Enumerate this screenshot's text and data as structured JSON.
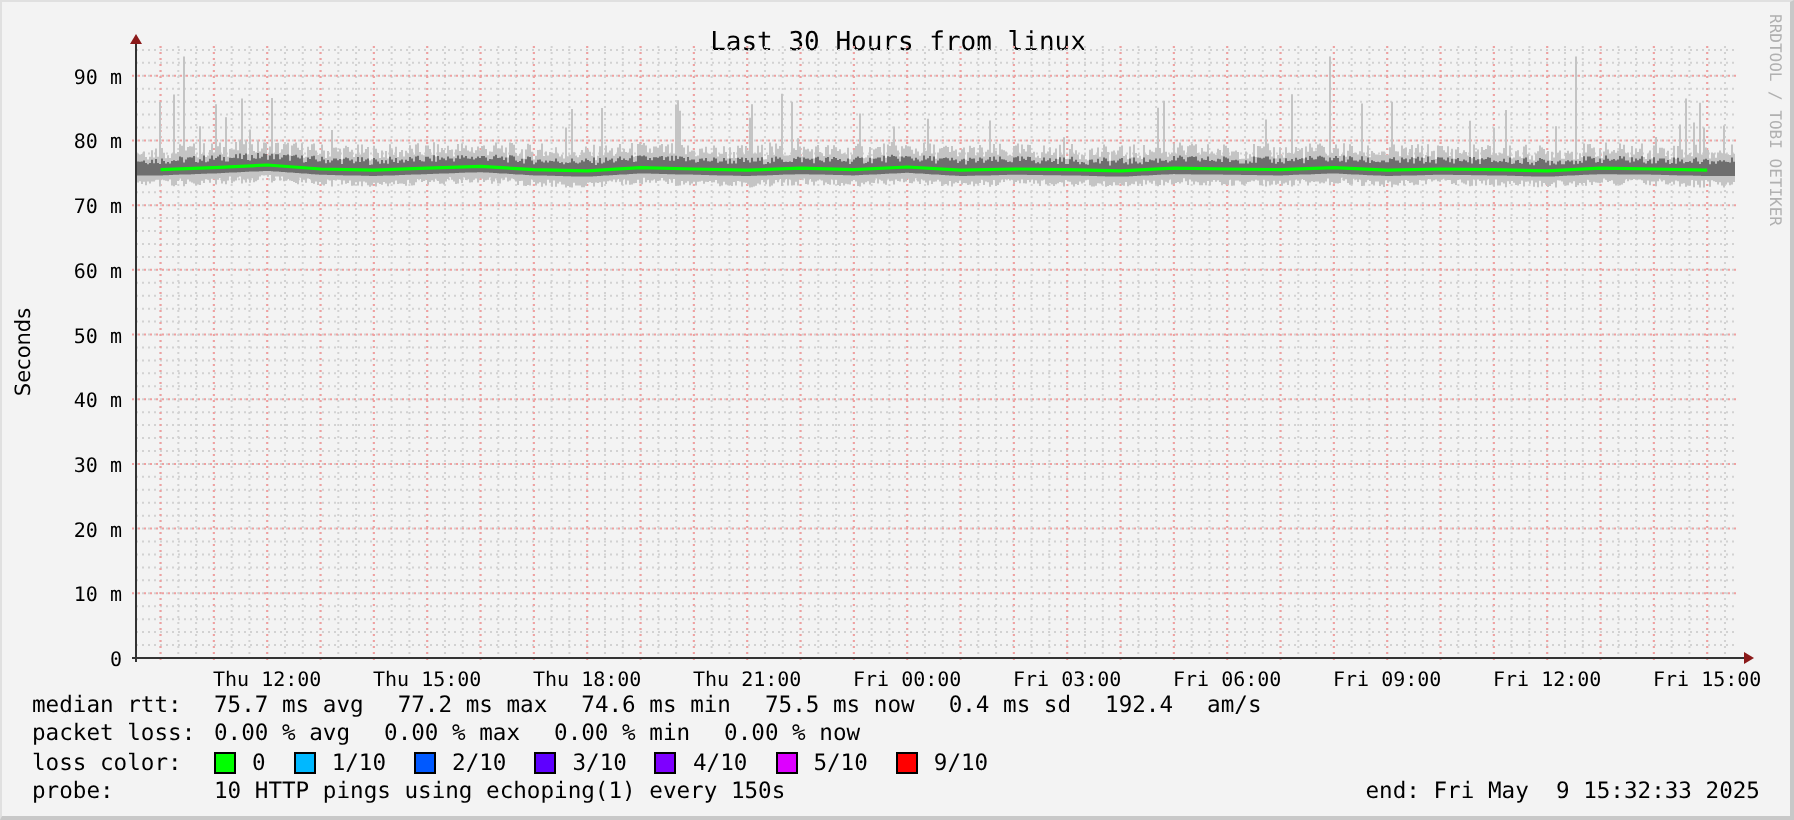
{
  "chart": {
    "title": "Last 30 Hours from linux",
    "watermark": "RRDTOOL / TOBI OETIKER",
    "chart_data": {
      "type": "line",
      "ylabel": "Seconds",
      "grid": true,
      "ylim": [
        0,
        94.6
      ],
      "categories": [
        null,
        null,
        "Thu 12:00",
        null,
        null,
        "Thu 15:00",
        null,
        null,
        "Thu 18:00",
        null,
        null,
        "Thu 21:00",
        null,
        null,
        "Fri 00:00",
        null,
        null,
        "Fri 03:00",
        null,
        null,
        "Fri 06:00",
        null,
        null,
        "Fri 09:00",
        null,
        null,
        "Fri 12:00",
        null,
        null,
        "Fri 15:00"
      ],
      "series": [
        {
          "color": "#00ff00",
          "values": [
            75.5,
            75.8,
            76.2,
            75.6,
            75.4,
            75.7,
            76.0,
            75.5,
            75.3,
            75.8,
            75.6,
            75.4,
            75.7,
            75.5,
            75.9,
            75.4,
            75.6,
            75.5,
            75.3,
            75.7,
            75.6,
            75.5,
            75.8,
            75.4,
            75.6,
            75.5,
            75.3,
            75.7,
            75.6,
            75.4
          ]
        }
      ],
      "yticks": [
        {
          "value": 0,
          "label": "0"
        },
        {
          "value": 10,
          "label": "10 m"
        },
        {
          "value": 20,
          "label": "20 m"
        },
        {
          "value": 30,
          "label": "30 m"
        },
        {
          "value": 40,
          "label": "40 m"
        },
        {
          "value": 50,
          "label": "50 m"
        },
        {
          "value": 60,
          "label": "60 m"
        },
        {
          "value": 70,
          "label": "70 m"
        },
        {
          "value": 80,
          "label": "80 m"
        },
        {
          "value": 90,
          "label": "90 m"
        }
      ]
    }
  },
  "legend": {
    "median_rtt": {
      "label": "median rtt:",
      "values": [
        "75.7 ms avg",
        "77.2 ms max",
        "74.6 ms min",
        "75.5 ms now",
        "0.4 ms sd",
        "192.4",
        "am/s"
      ]
    },
    "packet_loss": {
      "label": "packet loss:",
      "values": [
        "0.00 % avg",
        "0.00 % max",
        "0.00 % min",
        "0.00 % now"
      ]
    },
    "loss_color": {
      "label": "loss color:",
      "items": [
        {
          "label": "0",
          "color": "#00ff00"
        },
        {
          "label": "1/10",
          "color": "#00b8ff"
        },
        {
          "label": "2/10",
          "color": "#0059ff"
        },
        {
          "label": "3/10",
          "color": "#5e00ff"
        },
        {
          "label": "4/10",
          "color": "#7e00ff"
        },
        {
          "label": "5/10",
          "color": "#dd00ff"
        },
        {
          "label": "9/10",
          "color": "#ff0000"
        }
      ]
    },
    "probe": {
      "label": "probe:",
      "text": "10 HTTP pings using echoping(1) every 150s"
    },
    "end": "end: Fri May  9 15:32:33 2025"
  }
}
